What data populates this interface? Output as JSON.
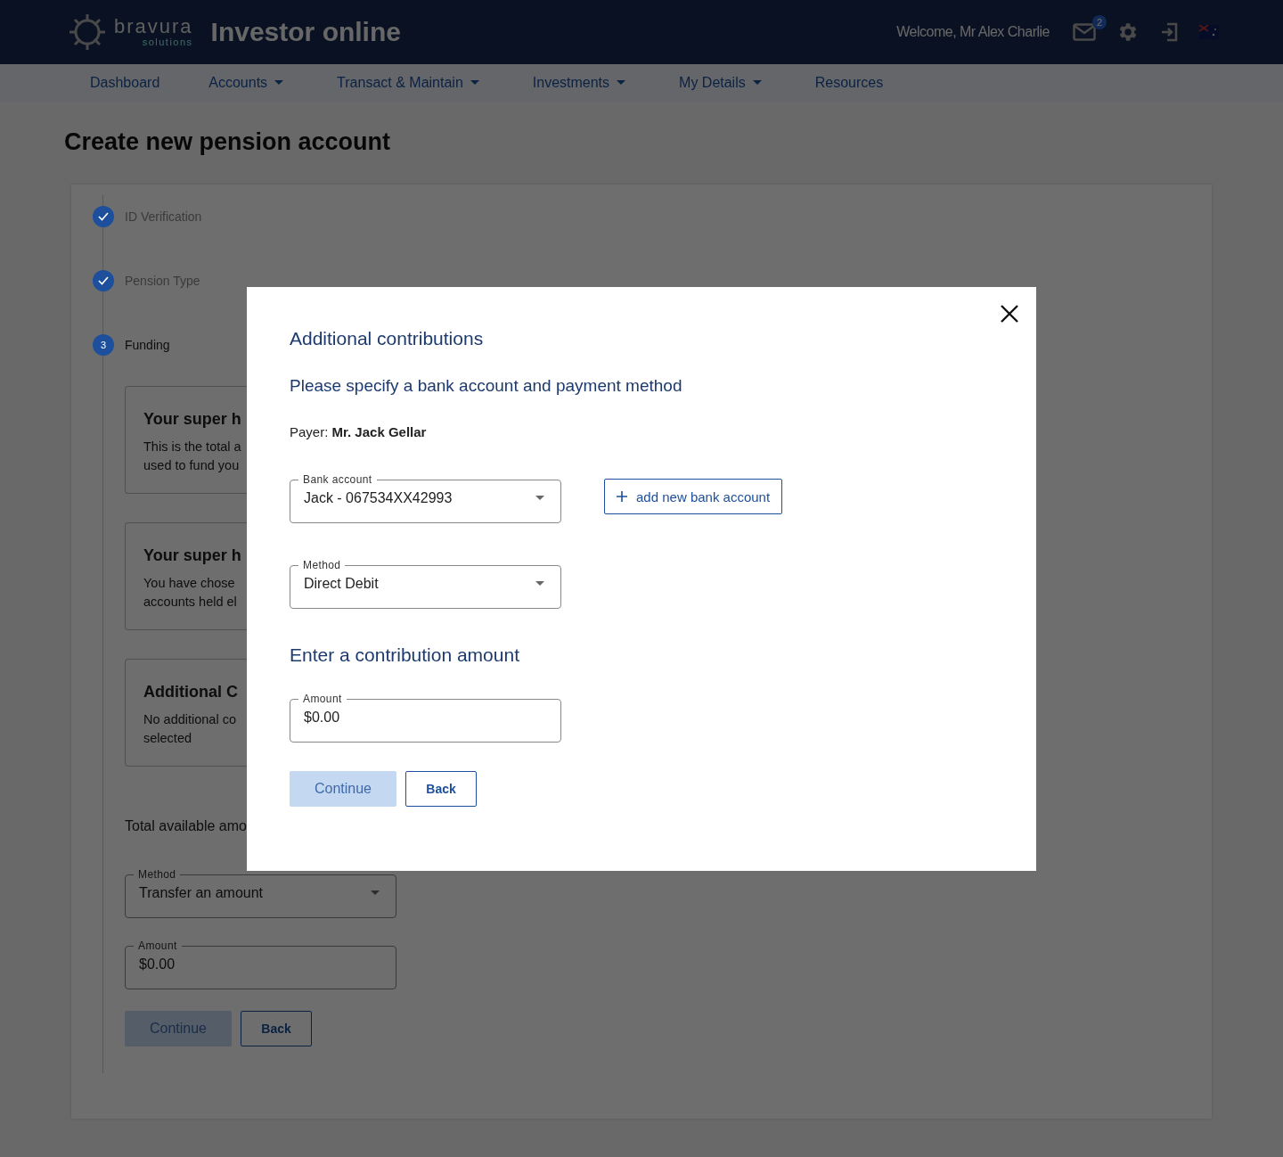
{
  "header": {
    "brand": "bravura",
    "brand_sub": "solutions",
    "title": "Investor online",
    "welcome": "Welcome, Mr Alex Charlie",
    "mail_count": "2"
  },
  "nav": [
    {
      "label": "Dashboard",
      "dropdown": false
    },
    {
      "label": "Accounts",
      "dropdown": true
    },
    {
      "label": "Transact & Maintain",
      "dropdown": true
    },
    {
      "label": "Investments",
      "dropdown": true
    },
    {
      "label": "My Details",
      "dropdown": true
    },
    {
      "label": "Resources",
      "dropdown": false
    }
  ],
  "page_title": "Create new pension account",
  "steps": [
    {
      "label": "ID Verification",
      "kind": "done"
    },
    {
      "label": "Pension Type",
      "kind": "done"
    },
    {
      "label": "Funding",
      "kind": "current",
      "number": "3"
    }
  ],
  "cards": [
    {
      "title": "Your super h",
      "lines": [
        "This is the total a",
        "used to fund you"
      ]
    },
    {
      "title": "Your super h",
      "lines": [
        "You have chose",
        "accounts held el"
      ]
    },
    {
      "title": "Additional C",
      "lines": [
        "No additional co",
        "selected"
      ]
    }
  ],
  "total_label": "Total available amo",
  "background_fields": [
    {
      "kind": "select",
      "label": "Method",
      "value": "Transfer an amount"
    },
    {
      "kind": "input",
      "label": "Amount",
      "value": "$0.00"
    }
  ],
  "background_buttons": [
    {
      "label": "Continue",
      "kind": "primary",
      "disabled": true
    },
    {
      "label": "Back",
      "kind": "secondary",
      "disabled": false
    }
  ],
  "dialog": {
    "title": "Additional contributions",
    "subtitle": "Please specify a bank account and payment method",
    "payer_label": "Payer:",
    "payer_name": "Mr. Jack Gellar",
    "fields": [
      {
        "kind": "select",
        "label": "Bank account",
        "value": "Jack - 067534XX42993"
      },
      {
        "kind": "select",
        "label": "Method",
        "value": "Direct Debit"
      }
    ],
    "add_button": "add new bank account",
    "amount_heading": "Enter a contribution amount",
    "amount_field": {
      "label": "Amount",
      "value": "$0.00"
    },
    "buttons": [
      {
        "label": "Continue",
        "kind": "primary",
        "disabled": true
      },
      {
        "label": "Back",
        "kind": "secondary",
        "disabled": false
      }
    ]
  }
}
